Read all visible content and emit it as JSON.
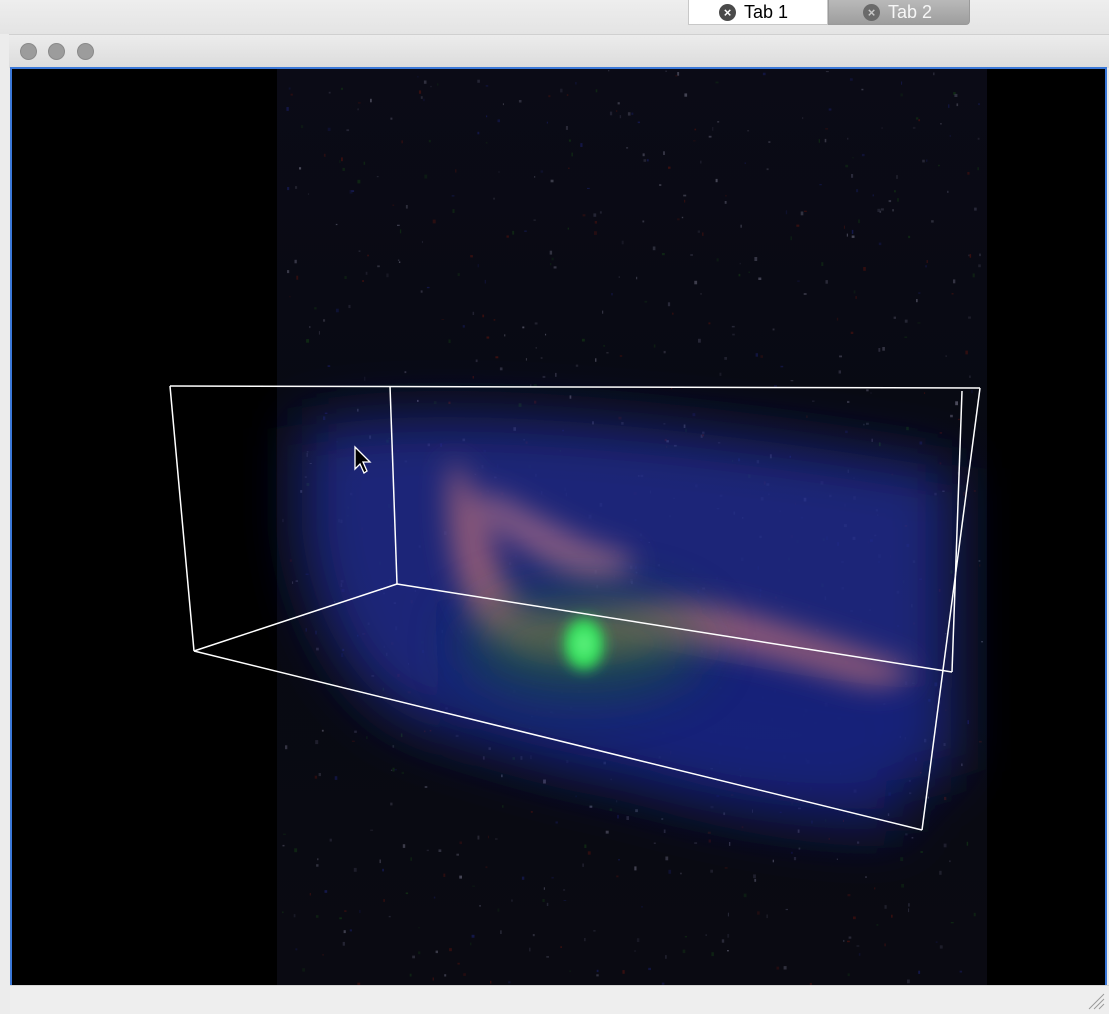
{
  "tabs": [
    {
      "label": "Tab 1",
      "active": true,
      "close_icon": "close-circle-icon"
    },
    {
      "label": "Tab 2",
      "active": false,
      "close_icon": "close-circle-icon"
    }
  ],
  "window": {
    "controls": [
      "close-dot",
      "minimize-dot",
      "zoom-dot"
    ]
  },
  "viewer": {
    "content": "3d-volume-render",
    "bounding_box_color": "#ffffff",
    "channel_colors": [
      "#2a3aa0",
      "#22d04a",
      "#c07080",
      "#cc2222"
    ]
  }
}
